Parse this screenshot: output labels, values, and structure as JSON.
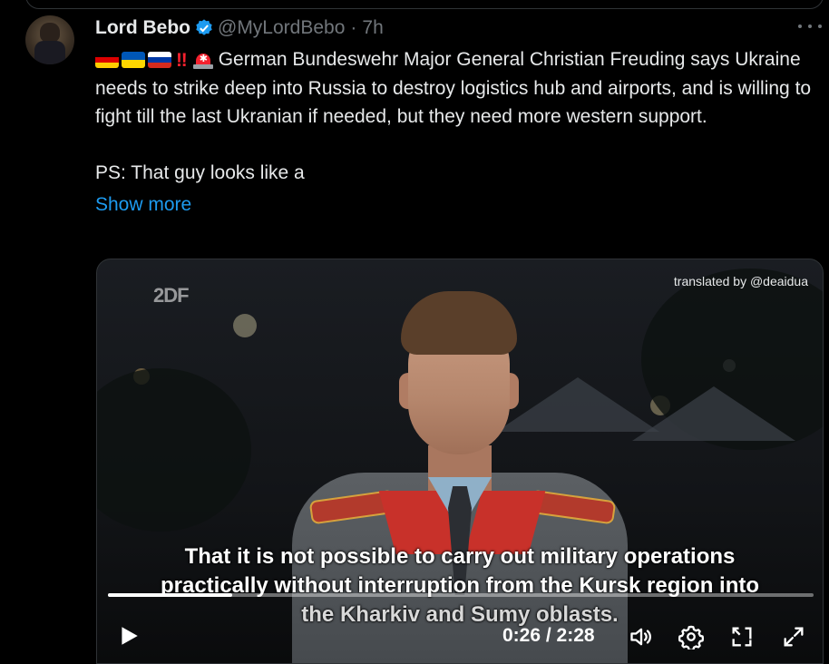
{
  "tweet": {
    "author_name": "Lord Bebo",
    "handle": "@MyLordBebo",
    "separator": "·",
    "time": "7h",
    "text_main": "German Bundeswehr Major General Christian Freuding says Ukraine needs to strike deep into Russia to destroy logistics hub and airports, and is willing to fight till the last Ukranian if needed, but they need more western support.",
    "text_ps": "PS: That guy looks like a",
    "show_more": "Show more",
    "emojis": [
      "german-flag",
      "ukraine-flag",
      "russia-flag",
      "double-exclamation",
      "police-siren"
    ],
    "bangbang": "‼"
  },
  "video": {
    "watermark": "2DF",
    "translated_by": "translated by @deaidua",
    "subtitles": [
      "That it is not possible to carry out military operations",
      "practically without interruption from the Kursk region into",
      "the Kharkiv and Sumy oblasts."
    ],
    "current_time": "0:26",
    "duration": "2:28",
    "time_label": "0:26 / 2:28",
    "progress_fraction": 0.176
  },
  "colors": {
    "background": "#000000",
    "text": "#e7e9ea",
    "secondary": "#71767b",
    "link": "#1d9bf0",
    "verified": "#1d9bf0"
  }
}
